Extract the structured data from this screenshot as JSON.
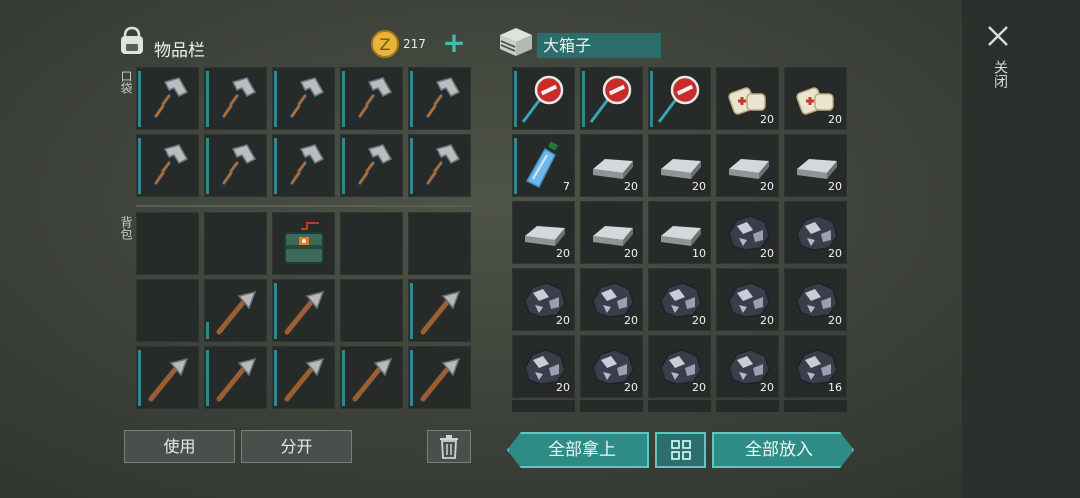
{
  "inventory": {
    "title": "物品栏",
    "coins": "217",
    "pocket_label": "口袋",
    "backpack_label": "背包"
  },
  "box": {
    "title": "大箱子"
  },
  "close": {
    "label": "关闭"
  },
  "buttons": {
    "use": "使用",
    "split": "分开",
    "take_all": "全部拿上",
    "put_all": "全部放入"
  },
  "colors": {
    "teal": "#2f8b86",
    "slot": "#262b29",
    "accent": "#2e8a8a"
  },
  "pocket_slots": [
    {
      "item": "hammer-icon"
    },
    {
      "item": "hammer-icon"
    },
    {
      "item": "hammer-icon"
    },
    {
      "item": "hammer-icon"
    },
    {
      "item": "hammer-icon"
    },
    {
      "item": "hammer-icon"
    },
    {
      "item": "hammer-icon"
    },
    {
      "item": "hammer-icon"
    },
    {
      "item": "hammer-icon"
    },
    {
      "item": "hammer-icon"
    }
  ],
  "backpack_slots": [
    {
      "item": ""
    },
    {
      "item": ""
    },
    {
      "item": "toolbox-icon"
    },
    {
      "item": ""
    },
    {
      "item": ""
    },
    {
      "item": ""
    },
    {
      "item": "pickaxe-icon",
      "durability": 0.3
    },
    {
      "item": "pickaxe-icon"
    },
    {
      "item": ""
    },
    {
      "item": "pickaxe-icon"
    },
    {
      "item": "pickaxe-icon"
    },
    {
      "item": "pickaxe-icon"
    },
    {
      "item": "pickaxe-icon"
    },
    {
      "item": "pickaxe-icon"
    },
    {
      "item": "pickaxe-icon"
    }
  ],
  "box_slots": [
    {
      "item": "stop-sign-icon",
      "count": ""
    },
    {
      "item": "stop-sign-icon",
      "count": ""
    },
    {
      "item": "stop-sign-icon",
      "count": ""
    },
    {
      "item": "bandage-icon",
      "count": "20"
    },
    {
      "item": "bandage-icon",
      "count": "20"
    },
    {
      "item": "water-bottle-icon",
      "count": "7"
    },
    {
      "item": "iron-ingot-icon",
      "count": "20"
    },
    {
      "item": "iron-ingot-icon",
      "count": "20"
    },
    {
      "item": "iron-ingot-icon",
      "count": "20"
    },
    {
      "item": "iron-ingot-icon",
      "count": "20"
    },
    {
      "item": "iron-ingot-icon",
      "count": "20"
    },
    {
      "item": "iron-ingot-icon",
      "count": "20"
    },
    {
      "item": "iron-ingot-icon",
      "count": "10"
    },
    {
      "item": "iron-ore-icon",
      "count": "20"
    },
    {
      "item": "iron-ore-icon",
      "count": "20"
    },
    {
      "item": "iron-ore-icon",
      "count": "20"
    },
    {
      "item": "iron-ore-icon",
      "count": "20"
    },
    {
      "item": "iron-ore-icon",
      "count": "20"
    },
    {
      "item": "iron-ore-icon",
      "count": "20"
    },
    {
      "item": "iron-ore-icon",
      "count": "20"
    },
    {
      "item": "iron-ore-icon",
      "count": "20"
    },
    {
      "item": "iron-ore-icon",
      "count": "20"
    },
    {
      "item": "iron-ore-icon",
      "count": "20"
    },
    {
      "item": "iron-ore-icon",
      "count": "20"
    },
    {
      "item": "iron-ore-icon",
      "count": "16"
    }
  ]
}
